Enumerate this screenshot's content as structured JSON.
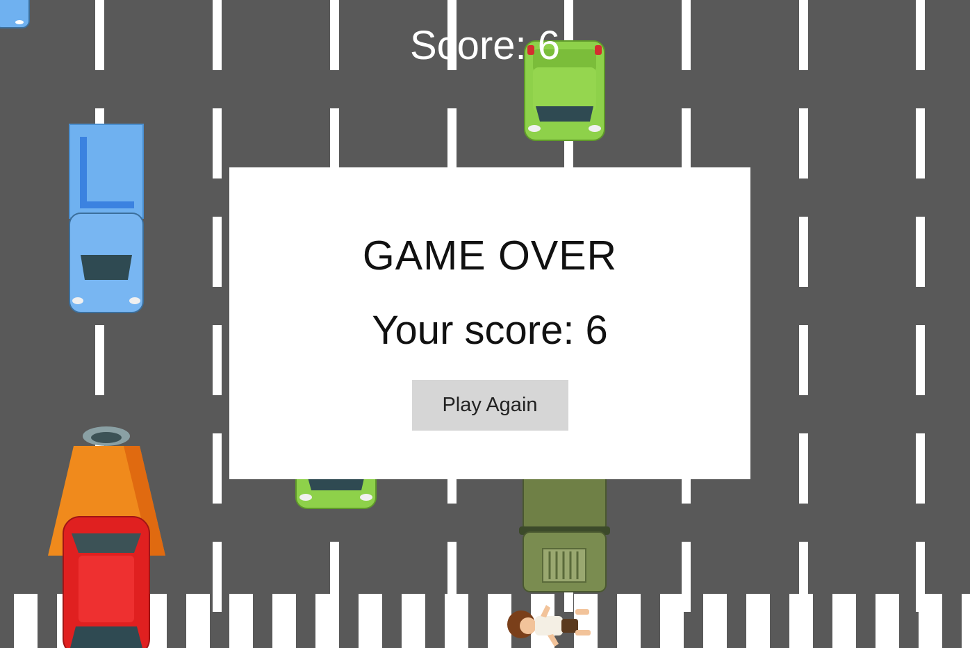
{
  "hud": {
    "score_text": "Score: 6"
  },
  "game_over": {
    "title": "GAME OVER",
    "score_text": "Your score: 6",
    "button_label": "Play Again"
  },
  "colors": {
    "road": "#595959",
    "lane_marking": "#ffffff",
    "car_green": "#8ed14a",
    "car_blue": "#6fb1f0",
    "car_orange": "#f08a1c",
    "car_red": "#e02020",
    "truck_olive": "#6f8046"
  },
  "icons": [
    "green-car-icon",
    "blue-truck-icon",
    "orange-tanker-icon",
    "red-car-icon",
    "olive-truck-icon",
    "pedestrian-icon"
  ]
}
